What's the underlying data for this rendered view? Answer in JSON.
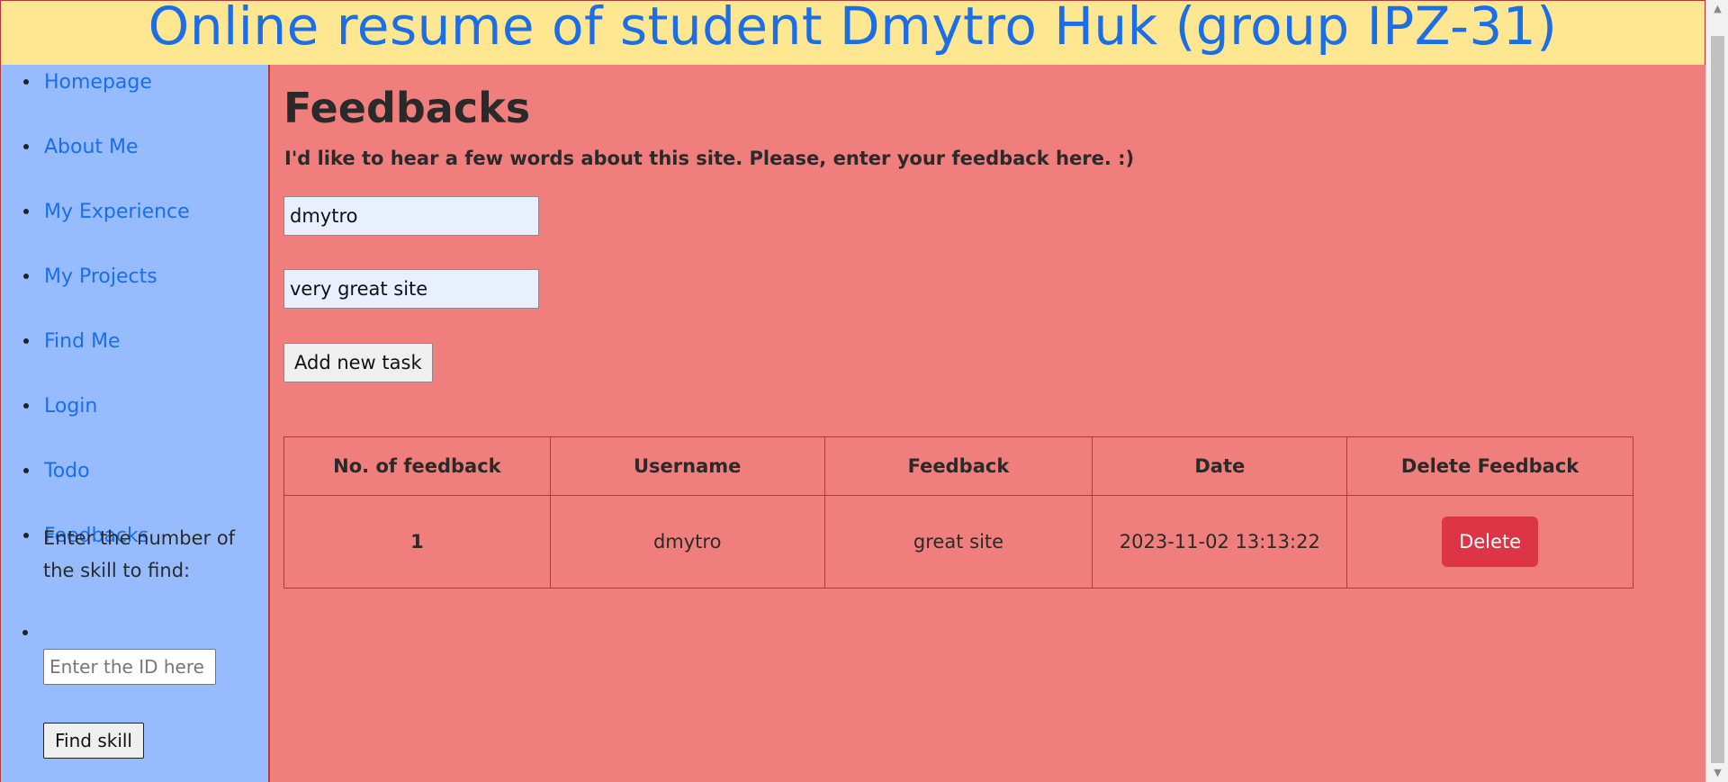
{
  "header": {
    "title": "Online resume of student Dmytro Huk (group IPZ-31)"
  },
  "sidebar": {
    "items": [
      {
        "label": "Homepage"
      },
      {
        "label": "About Me"
      },
      {
        "label": "My Experience"
      },
      {
        "label": "My Projects"
      },
      {
        "label": "Find Me"
      },
      {
        "label": "Login"
      },
      {
        "label": "Todo"
      },
      {
        "label": "Feedbacks"
      }
    ],
    "skill_search": {
      "label": "Enter the number of the skill to find:",
      "placeholder": "Enter the ID here",
      "button_label": "Find skill"
    }
  },
  "main": {
    "title": "Feedbacks",
    "intro": "I'd like to hear a few words about this site. Please, enter your feedback here. :)",
    "form": {
      "username_value": "dmytro",
      "feedback_value": "very great site",
      "submit_label": "Add new task"
    },
    "table": {
      "headers": [
        "No. of feedback",
        "Username",
        "Feedback",
        "Date",
        "Delete Feedback"
      ],
      "rows": [
        {
          "number": "1",
          "username": "dmytro",
          "feedback": "great site",
          "date": "2023-11-02 13:13:22",
          "action_label": "Delete"
        }
      ]
    }
  },
  "colors": {
    "header_bg": "#ffe690",
    "sidebar_bg": "#96bcff",
    "main_bg": "#f07e7c",
    "link": "#1a6ee8",
    "delete_button": "#dc3545",
    "border": "#b33a3a"
  },
  "icons": {
    "scroll_up": "scroll-up-arrow-icon",
    "scroll_down": "scroll-down-arrow-icon"
  }
}
